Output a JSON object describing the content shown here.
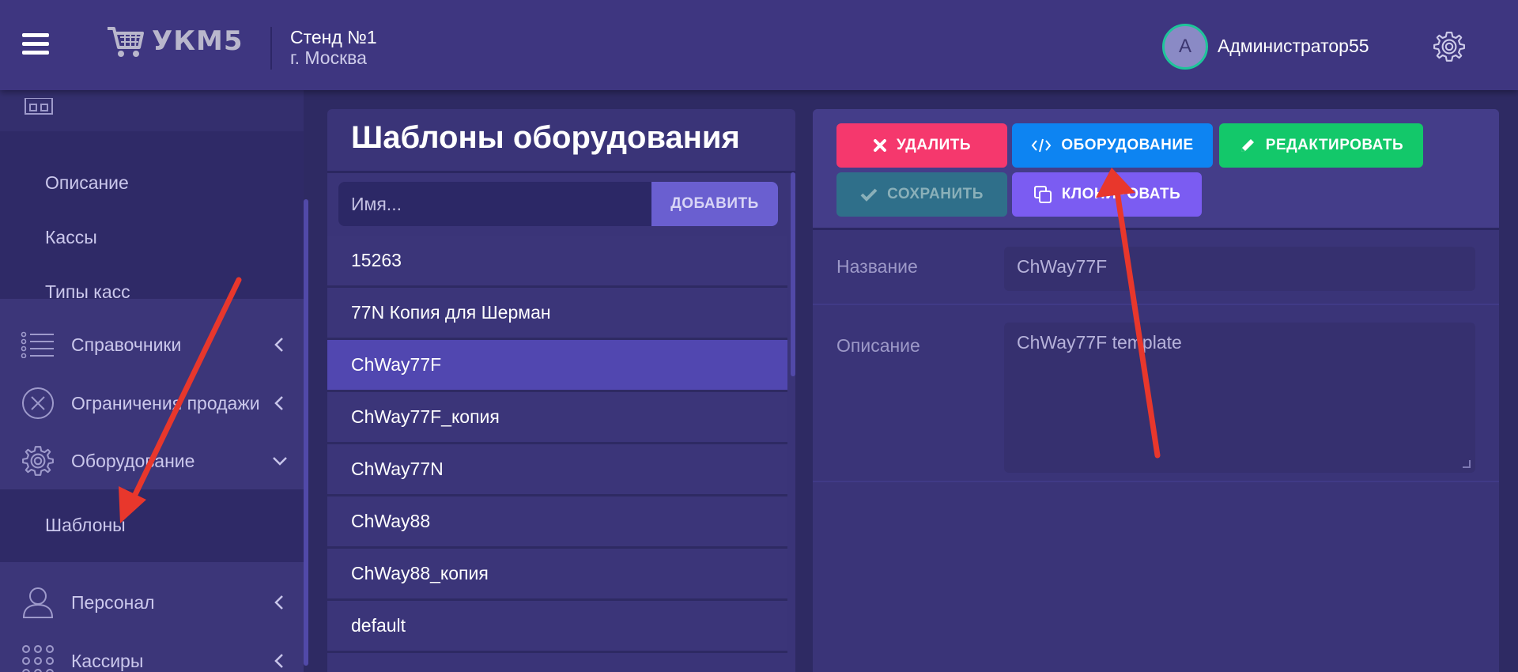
{
  "header": {
    "logo_text": "УКМ5",
    "stand_name": "Стенд №1",
    "stand_city": "г. Москва",
    "avatar_letter": "А",
    "user_name": "Администратор55"
  },
  "sidebar": {
    "subitems_top": [
      "Описание",
      "Кассы",
      "Типы касс"
    ],
    "items": [
      {
        "label": "Справочники",
        "icon": "list-icon",
        "chevron": "left"
      },
      {
        "label": "Ограничения продажи",
        "icon": "circle-x-icon",
        "chevron": "left"
      },
      {
        "label": "Оборудование",
        "icon": "gear-icon",
        "chevron": "down"
      },
      {
        "label": "Персонал",
        "icon": "person-icon",
        "chevron": "left"
      },
      {
        "label": "Кассиры",
        "icon": "grid-dots-icon",
        "chevron": "left"
      }
    ],
    "active_subitem": "Шаблоны"
  },
  "templates_panel": {
    "title": "Шаблоны оборудования",
    "search_placeholder": "Имя...",
    "add_label": "ДОБАВИТЬ",
    "items": [
      "15263",
      "77N Копия для Шерман",
      "ChWay77F",
      "ChWay77F_копия",
      "ChWay77N",
      "ChWay88",
      "ChWay88_копия",
      "default"
    ],
    "selected": "ChWay77F"
  },
  "detail_panel": {
    "buttons": {
      "delete": "УДАЛИТЬ",
      "equipment": "ОБОРУДОВАНИЕ",
      "edit": "РЕДАКТИРОВАТЬ",
      "save": "СОХРАНИТЬ",
      "clone": "КЛОНИРОВАТЬ"
    },
    "fields": {
      "name_label": "Название",
      "name_value": "ChWay77F",
      "description_label": "Описание",
      "description_value": "ChWay77F template"
    }
  },
  "colors": {
    "header_bg": "#3e3680",
    "panel_bg": "#3a3478",
    "delete": "#f5386d",
    "equipment": "#0d84f2",
    "edit": "#13c86a",
    "save_disabled": "#2f6f8a",
    "clone": "#7b5cf2",
    "selected_row": "#5147b0",
    "annotation_arrow": "#e8372c"
  }
}
